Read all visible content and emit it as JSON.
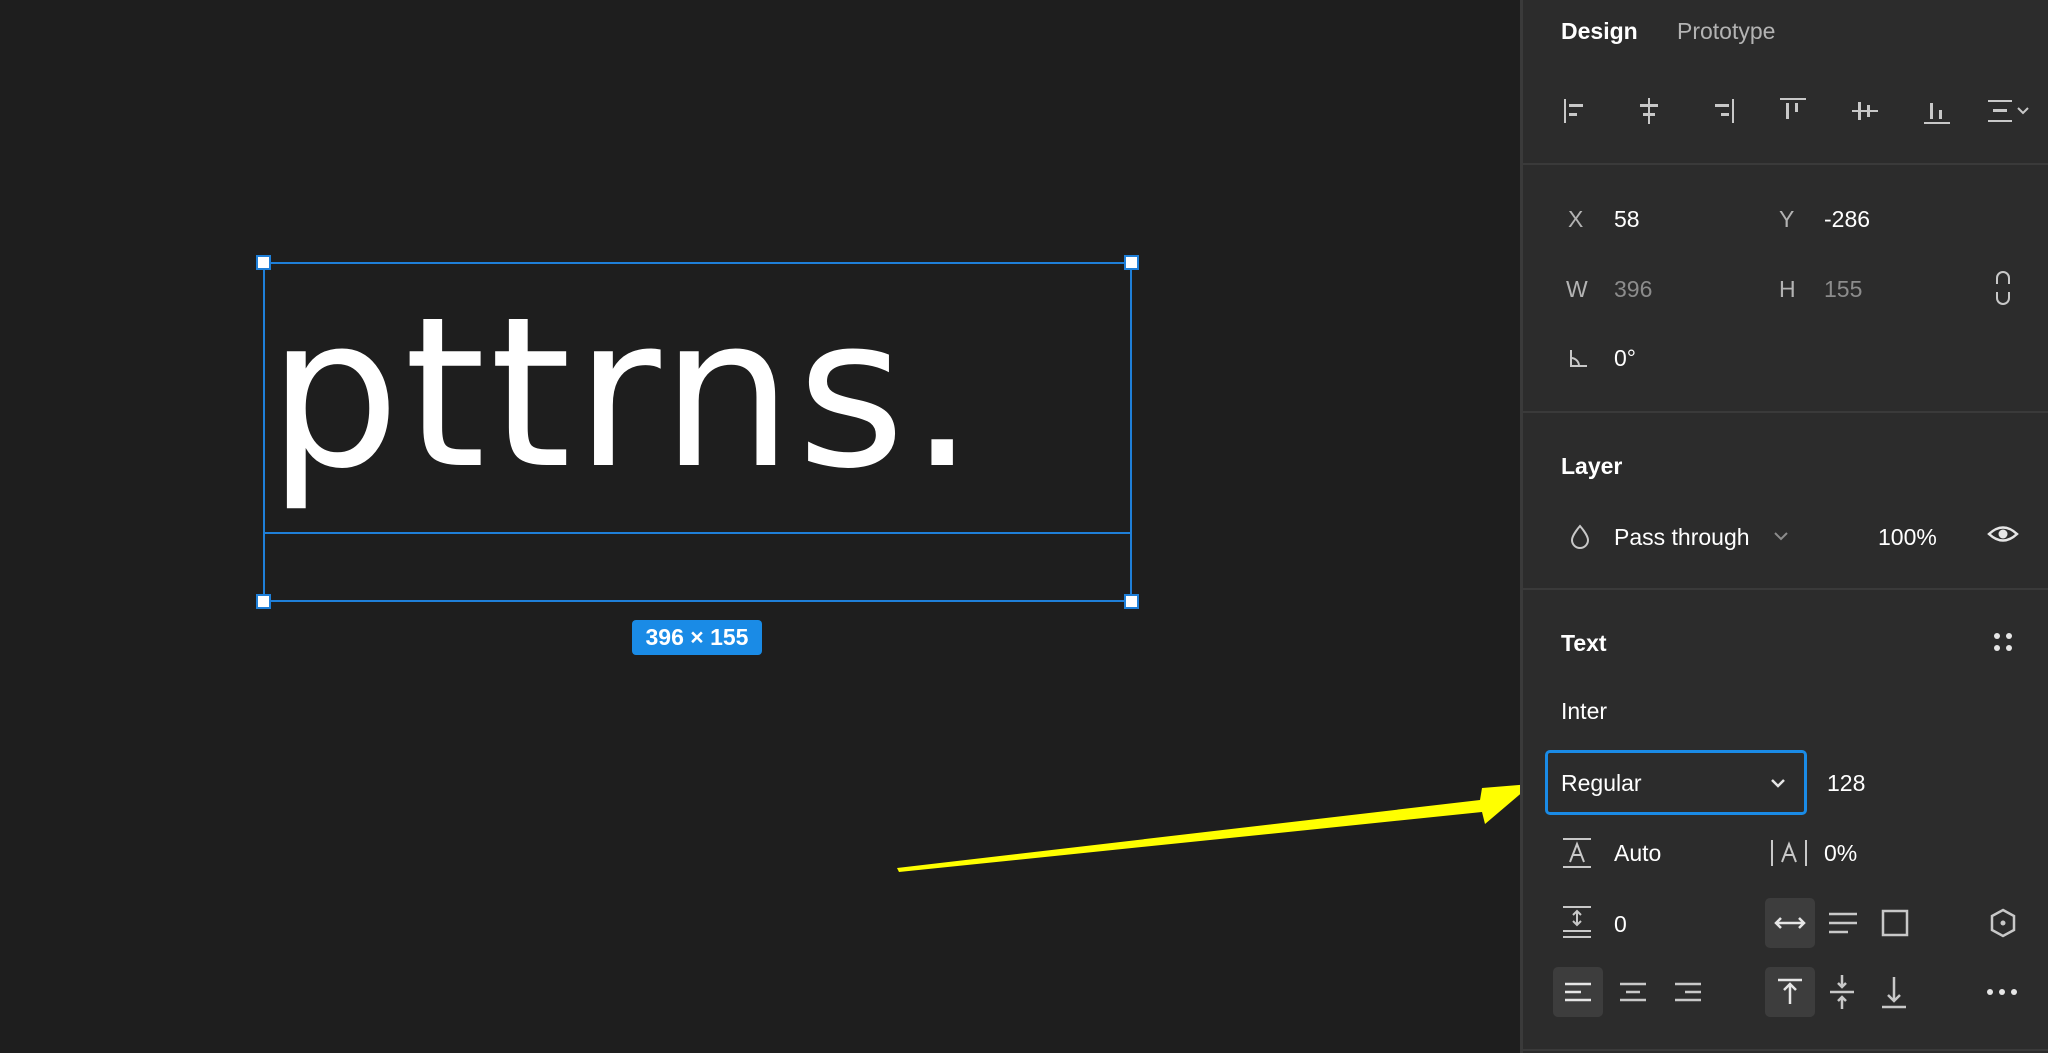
{
  "canvas": {
    "text": "pttrns.",
    "size_badge": "396 × 155"
  },
  "panel": {
    "tabs": {
      "design": "Design",
      "prototype": "Prototype"
    },
    "position": {
      "x_label": "X",
      "x_value": "58",
      "y_label": "Y",
      "y_value": "-286",
      "w_label": "W",
      "w_value": "396",
      "h_label": "H",
      "h_value": "155",
      "rotation_value": "0°"
    },
    "layer": {
      "title": "Layer",
      "blend_mode": "Pass through",
      "opacity": "100%"
    },
    "text": {
      "title": "Text",
      "font_family": "Inter",
      "font_style": "Regular",
      "font_size": "128",
      "line_height": "Auto",
      "letter_spacing": "0%",
      "paragraph_spacing": "0"
    }
  },
  "colors": {
    "canvas_bg": "#1e1e1e",
    "panel_bg": "#2c2c2c",
    "selection": "#1f7fd8",
    "accent": "#1a8be6",
    "annotation_arrow": "#ffff00"
  }
}
